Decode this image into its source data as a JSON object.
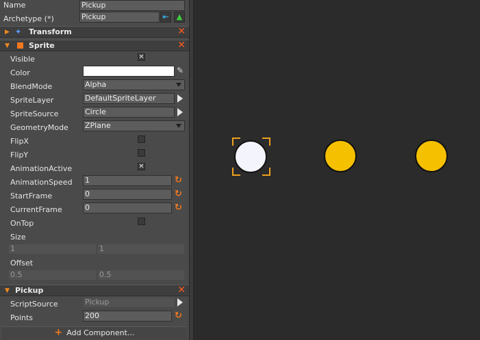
{
  "inspector": {
    "name_label": "Name",
    "name_value": "Pickup",
    "archetype_label": "Archetype (*)",
    "archetype_value": "Pickup",
    "archetype_upload_icon": "arrow-left-into-tray-icon",
    "archetype_upload_color": "#33c6ff",
    "archetype_push_icon": "arrow-up-icon",
    "archetype_push_color": "#3cd23c",
    "components": {
      "transform": {
        "title": "Transform",
        "expanded": false
      },
      "sprite": {
        "title": "Sprite",
        "expanded": true,
        "properties": {
          "visible": {
            "label": "Visible",
            "checked": true
          },
          "color": {
            "label": "Color",
            "value": "#ffffff"
          },
          "blend_mode": {
            "label": "BlendMode",
            "value": "Alpha"
          },
          "sprite_layer": {
            "label": "SpriteLayer",
            "value": "DefaultSpriteLayer"
          },
          "sprite_source": {
            "label": "SpriteSource",
            "value": "Circle"
          },
          "geometry_mode": {
            "label": "GeometryMode",
            "value": "ZPlane"
          },
          "flip_x": {
            "label": "FlipX",
            "checked": false
          },
          "flip_y": {
            "label": "FlipY",
            "checked": false
          },
          "animation_active": {
            "label": "AnimationActive",
            "checked": true
          },
          "animation_speed": {
            "label": "AnimationSpeed",
            "value": "1"
          },
          "start_frame": {
            "label": "StartFrame",
            "value": "0"
          },
          "current_frame": {
            "label": "CurrentFrame",
            "value": "0"
          },
          "on_top": {
            "label": "OnTop",
            "checked": false
          },
          "size": {
            "label": "Size",
            "x": "1",
            "y": "1"
          },
          "offset": {
            "label": "Offset",
            "x": "0.5",
            "y": "0.5"
          }
        }
      },
      "pickup": {
        "title": "Pickup",
        "expanded": true,
        "properties": {
          "script_source": {
            "label": "ScriptSource",
            "value": "Pickup"
          },
          "points": {
            "label": "Points",
            "value": "200"
          }
        }
      }
    },
    "add_component_label": "Add Component..."
  },
  "viewport": {
    "objects": [
      {
        "name": "selected-pickup",
        "color": "#f4f4fc",
        "selected": true
      },
      {
        "name": "pickup",
        "color": "#f5c000",
        "selected": false
      },
      {
        "name": "pickup",
        "color": "#f5c000",
        "selected": false
      }
    ],
    "selection_color": "#f0a020"
  },
  "colors": {
    "accent": "#f08a20",
    "remove": "#ff5a1e",
    "panel": "#4a4a4a",
    "viewport": "#2b2b2b"
  }
}
